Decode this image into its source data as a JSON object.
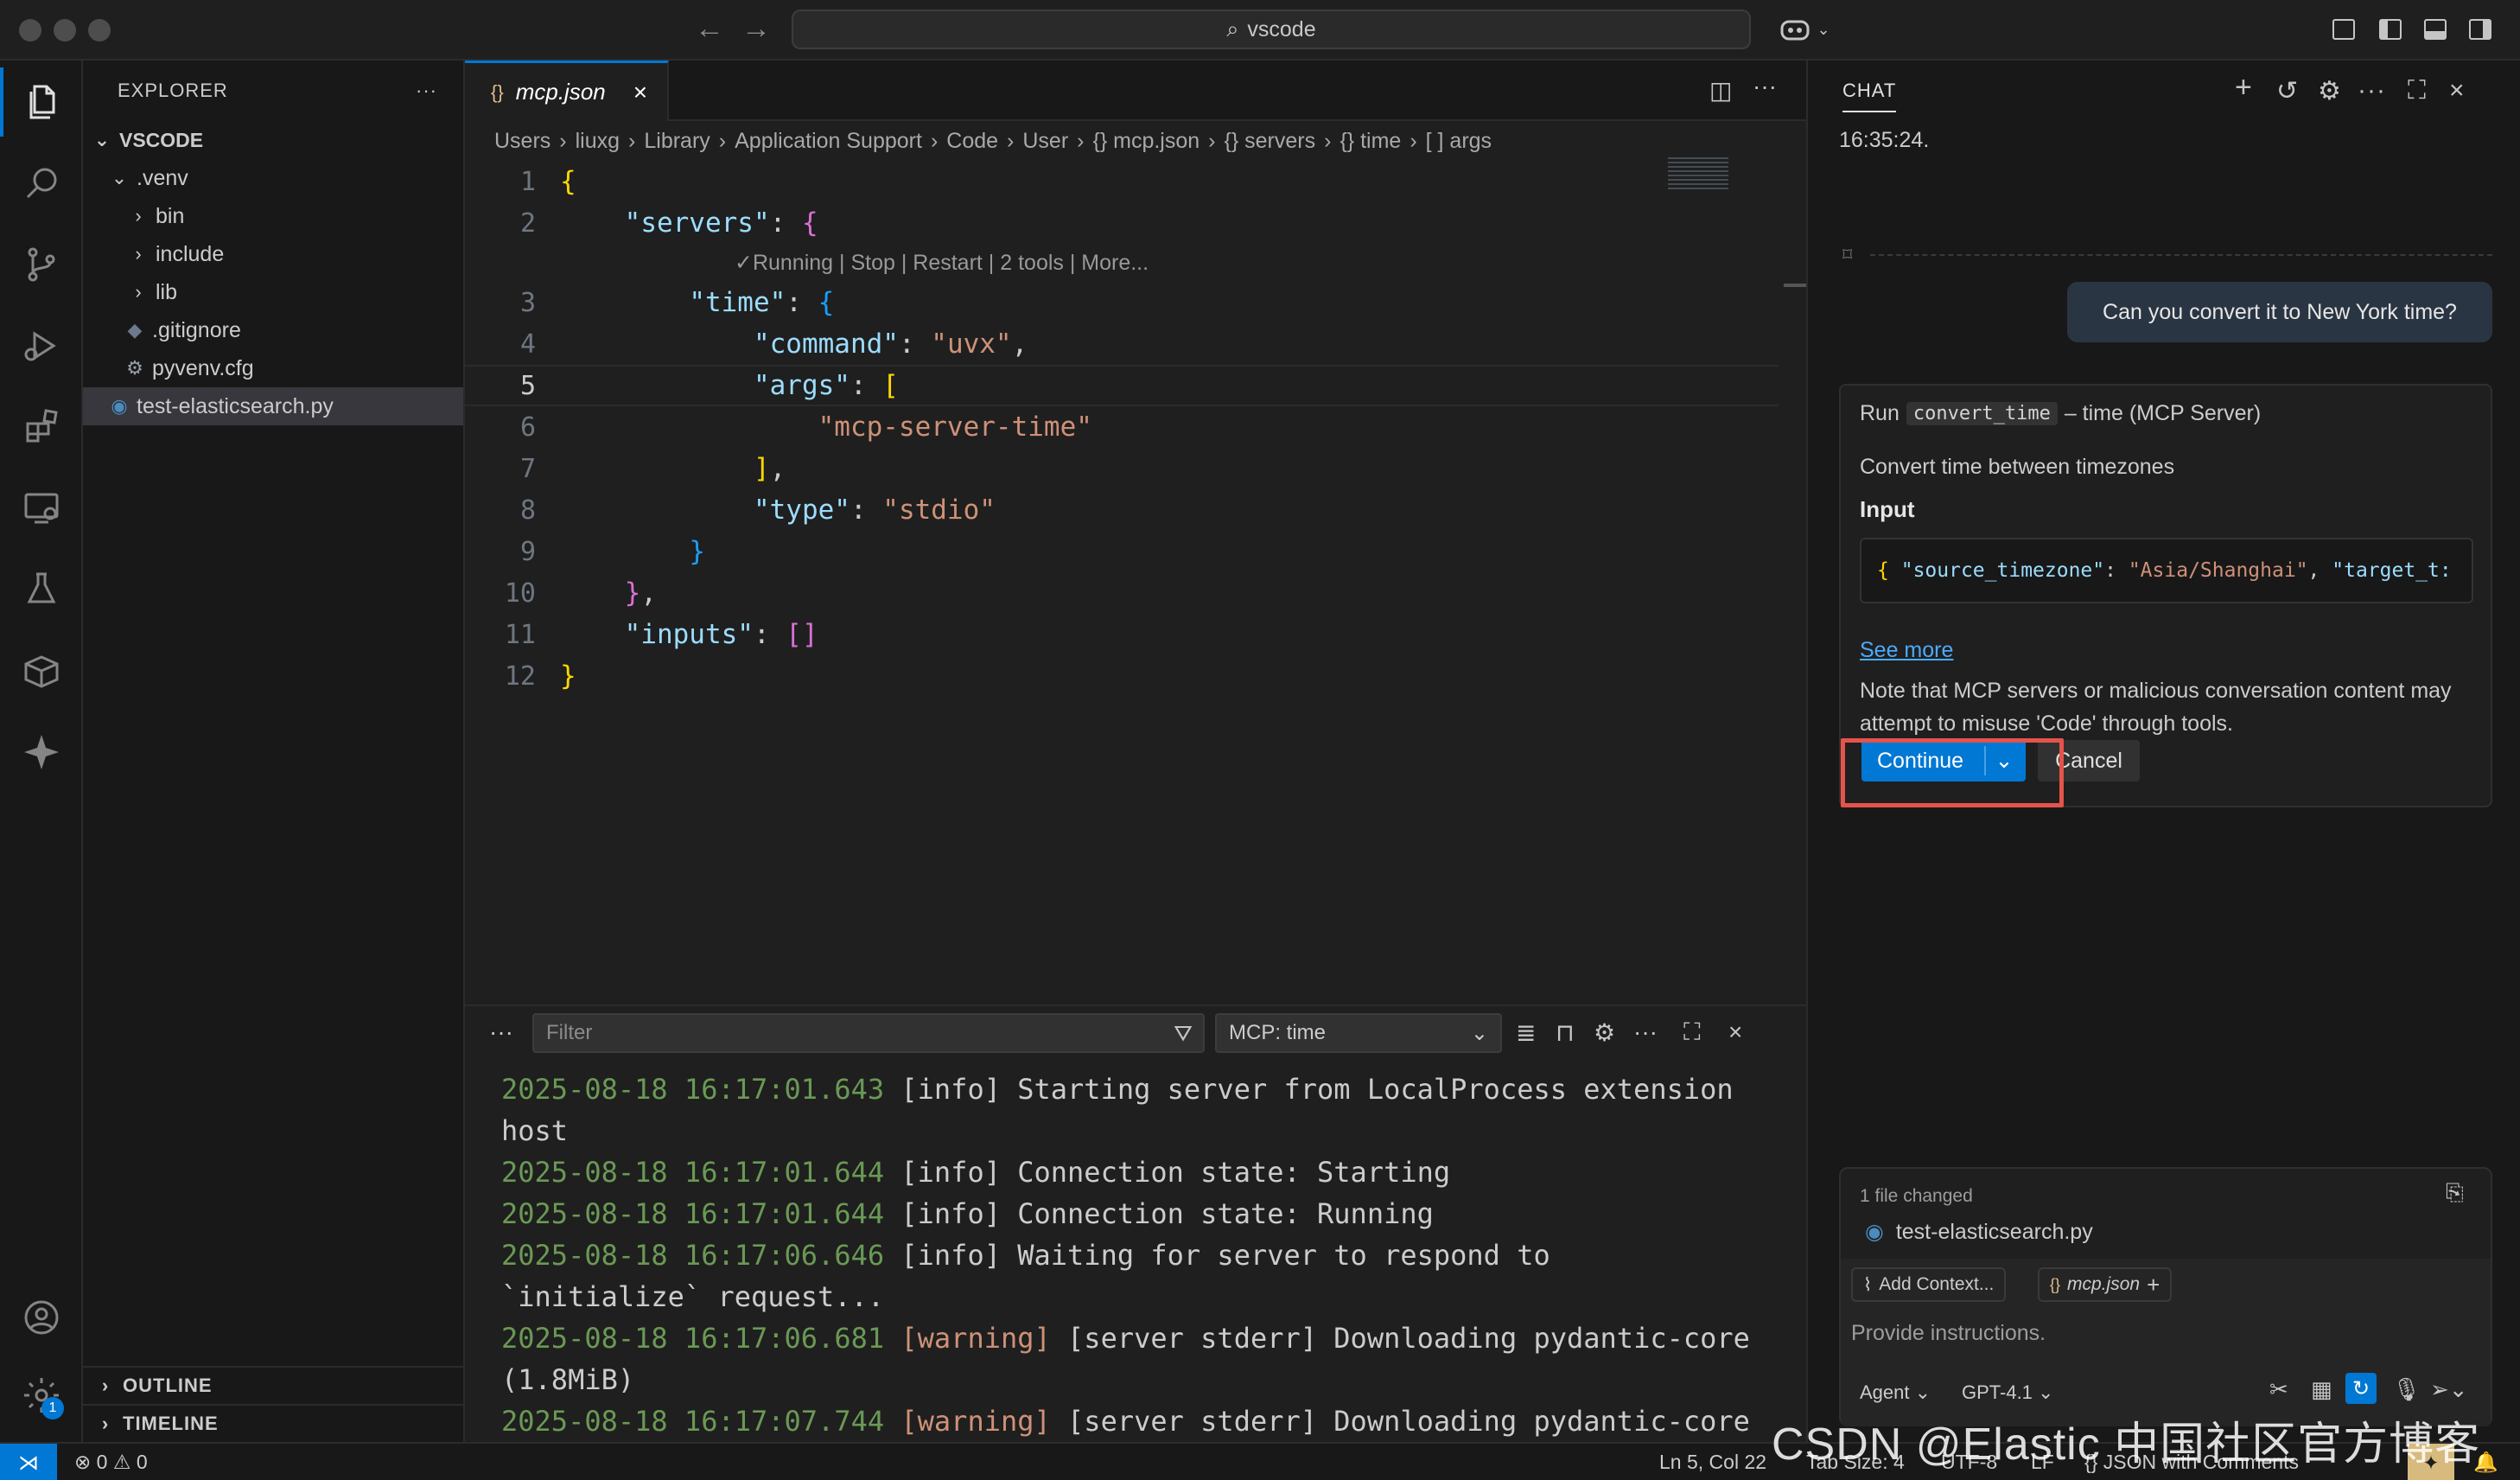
{
  "titlebar": {
    "search_text": "vscode"
  },
  "activity": {
    "badge_count": "1"
  },
  "explorer": {
    "header": "EXPLORER",
    "root": "VSCODE",
    "items": [
      {
        "label": ".venv",
        "type": "folder-open"
      },
      {
        "label": "bin",
        "type": "folder"
      },
      {
        "label": "include",
        "type": "folder"
      },
      {
        "label": "lib",
        "type": "folder"
      },
      {
        "label": ".gitignore",
        "type": "file"
      },
      {
        "label": "pyvenv.cfg",
        "type": "file"
      },
      {
        "label": "test-elasticsearch.py",
        "type": "file"
      }
    ],
    "outline": "OUTLINE",
    "timeline": "TIMELINE"
  },
  "editor": {
    "tab_label": "mcp.json",
    "tab_icon": "{}",
    "breadcrumb": [
      "Users",
      "liuxg",
      "Library",
      "Application Support",
      "Code",
      "User",
      "{} mcp.json",
      "{} servers",
      "{} time",
      "[ ] args"
    ],
    "codelens": "✓Running | Stop | Restart | 2 tools | More...",
    "line_numbers": [
      "1",
      "2",
      "3",
      "4",
      "5",
      "6",
      "7",
      "8",
      "9",
      "10",
      "11",
      "12"
    ],
    "current_line": "5",
    "code": {
      "servers_key": "\"servers\"",
      "time_key": "\"time\"",
      "command_key": "\"command\"",
      "command_val": "\"uvx\"",
      "args_key": "\"args\"",
      "args_item": "\"mcp-server-time\"",
      "type_key": "\"type\"",
      "type_val": "\"stdio\"",
      "inputs_key": "\"inputs\""
    }
  },
  "panel": {
    "filter_placeholder": "Filter",
    "channel": "MCP: time",
    "log": [
      {
        "ts": "2025-08-18 16:17:01.643",
        "level": "[info]",
        "msg": "Starting server from LocalProcess extension"
      },
      {
        "ts": "",
        "level": "",
        "msg": "host"
      },
      {
        "ts": "2025-08-18 16:17:01.644",
        "level": "[info]",
        "msg": "Connection state: Starting"
      },
      {
        "ts": "2025-08-18 16:17:01.644",
        "level": "[info]",
        "msg": "Connection state: Running"
      },
      {
        "ts": "2025-08-18 16:17:06.646",
        "level": "[info]",
        "msg": "Waiting for server to respond to"
      },
      {
        "ts": "",
        "level": "",
        "msg": "`initialize` request..."
      },
      {
        "ts": "2025-08-18 16:17:06.681",
        "level": "[warning]",
        "msg": "[server stderr] Downloading pydantic-core"
      },
      {
        "ts": "",
        "level": "",
        "msg": "(1.8MiB)"
      },
      {
        "ts": "2025-08-18 16:17:07.744",
        "level": "[warning]",
        "msg": "[server stderr]  Downloading pydantic-core"
      }
    ]
  },
  "chat": {
    "header": "CHAT",
    "prev_time": "16:35:24.",
    "user_message": "Can you convert it to New York time?",
    "tool": {
      "run_prefix": "Run",
      "tool_name": "convert_time",
      "server": "– time (MCP Server)",
      "description": "Convert time between timezones",
      "input_label": "Input",
      "json_open": "{",
      "json_key1": "\"source_timezone\"",
      "json_val1": "\"Asia/Shanghai\"",
      "json_key2": "\"target_t:",
      "see_more": "See more",
      "warning": "Note that MCP servers or malicious conversation content may attempt to misuse 'Code' through tools.",
      "continue_label": "Continue",
      "cancel_label": "Cancel"
    },
    "files_changed": "1 file changed",
    "changed_file": "test-elasticsearch.py",
    "add_context": "Add Context...",
    "context_file": "mcp.json",
    "input_placeholder": "Provide instructions.",
    "mode": "Agent",
    "model": "GPT-4.1"
  },
  "statusbar": {
    "errors": "0",
    "warnings": "0",
    "position": "Ln 5, Col 22",
    "tab_size": "Tab Size: 4",
    "encoding": "UTF-8",
    "eol": "LF",
    "language": "JSON with Comments"
  },
  "watermark": "CSDN @Elastic 中国社区官方博客"
}
